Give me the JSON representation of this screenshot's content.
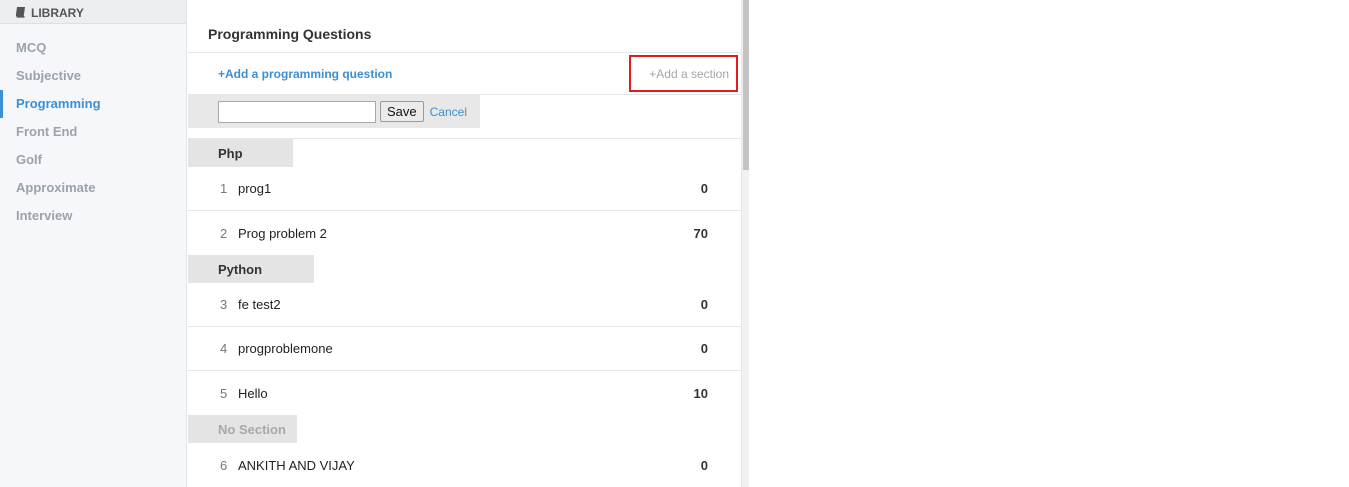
{
  "sidebar": {
    "header": "LIBRARY",
    "header_icon": "book-icon",
    "items": [
      {
        "label": "MCQ",
        "active": false
      },
      {
        "label": "Subjective",
        "active": false
      },
      {
        "label": "Programming",
        "active": true
      },
      {
        "label": "Front End",
        "active": false
      },
      {
        "label": "Golf",
        "active": false
      },
      {
        "label": "Approximate",
        "active": false
      },
      {
        "label": "Interview",
        "active": false
      }
    ]
  },
  "main": {
    "title": "Programming Questions",
    "add_question_label": "+Add a programming question",
    "add_section_label": "+Add a section",
    "form": {
      "input_value": "",
      "save_label": "Save",
      "cancel_label": "Cancel"
    },
    "sections": [
      {
        "name": "Php",
        "questions": [
          {
            "num": "1",
            "name": "prog1",
            "score": "0"
          },
          {
            "num": "2",
            "name": "Prog problem 2",
            "score": "70"
          }
        ]
      },
      {
        "name": "Python",
        "questions": [
          {
            "num": "3",
            "name": "fe test2",
            "score": "0"
          },
          {
            "num": "4",
            "name": "progproblemone",
            "score": "0"
          },
          {
            "num": "5",
            "name": "Hello",
            "score": "10"
          }
        ]
      },
      {
        "name": "No Section",
        "questions": [
          {
            "num": "6",
            "name": "ANKITH AND VIJAY",
            "score": "0"
          }
        ]
      }
    ]
  },
  "colors": {
    "accent": "#3a8fd6",
    "highlight": "#e21b1b",
    "section_bg": "#e4e4e4"
  }
}
